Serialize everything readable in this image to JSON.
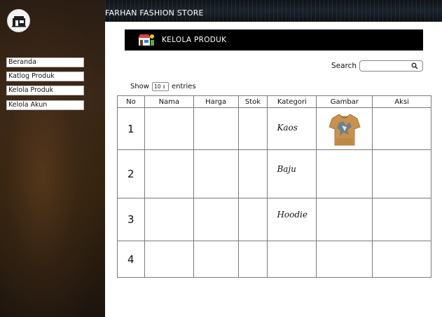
{
  "store": {
    "name": "FARHAN FASHION STORE"
  },
  "sidebar": {
    "items": [
      {
        "label": "Beranda"
      },
      {
        "label": "Katlog Produk"
      },
      {
        "label": "Kelola Produk"
      },
      {
        "label": "Kelola Akun"
      }
    ]
  },
  "header": {
    "title": "KELOLA PRODUK",
    "icon": "store-icon"
  },
  "search": {
    "label": "Search",
    "value": "",
    "icon": "search-icon"
  },
  "entries": {
    "show_label": "Show",
    "selected": "10",
    "suffix": "entries"
  },
  "table": {
    "columns": [
      "No",
      "Nama",
      "Harga",
      "Stok",
      "Kategori",
      "Gambar",
      "Aksi"
    ],
    "rows": [
      {
        "no": "1",
        "nama": "",
        "harga": "",
        "stok": "",
        "kategori": "Kaos",
        "gambar": "tshirt-image",
        "aksi": ""
      },
      {
        "no": "2",
        "nama": "",
        "harga": "",
        "stok": "",
        "kategori": "Baju",
        "gambar": "",
        "aksi": ""
      },
      {
        "no": "3",
        "nama": "",
        "harga": "",
        "stok": "",
        "kategori": "Hoodie",
        "gambar": "",
        "aksi": ""
      },
      {
        "no": "4",
        "nama": "",
        "harga": "",
        "stok": "",
        "kategori": "",
        "gambar": "",
        "aksi": ""
      }
    ]
  },
  "colors": {
    "sidebar": "#2f2115",
    "topbar": "#141a20",
    "banner": "#000000",
    "shirt": "#c8924e"
  }
}
